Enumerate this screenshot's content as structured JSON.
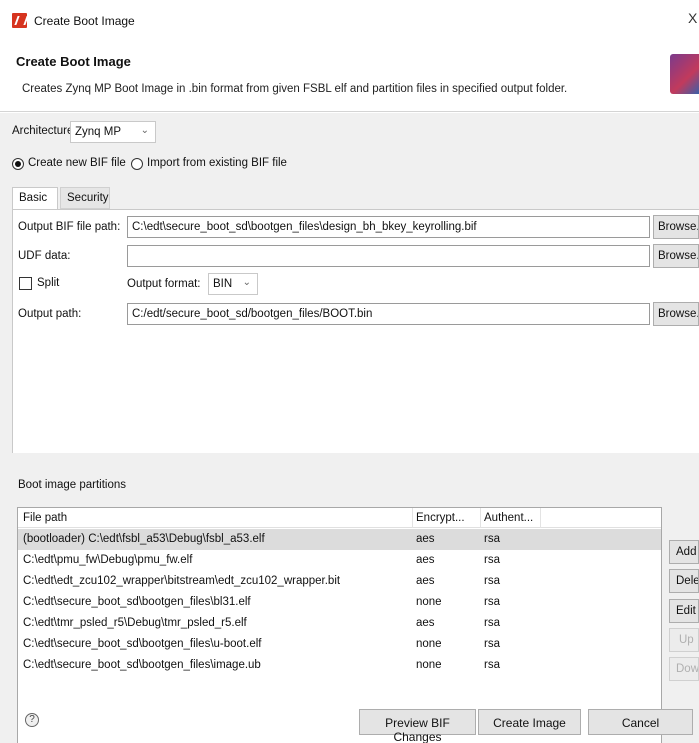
{
  "window": {
    "title": "Create Boot Image",
    "close": "X"
  },
  "header": {
    "title": "Create Boot Image",
    "description": "Creates Zynq MP Boot Image in .bin format from given FSBL elf and partition files in specified output folder."
  },
  "architecture": {
    "label": "Architecture:",
    "value": "Zynq MP"
  },
  "bif_mode": {
    "create_label": "Create new BIF file",
    "import_label": "Import from existing BIF file",
    "selected": "create"
  },
  "tabs": [
    {
      "label": "Basic",
      "active": true
    },
    {
      "label": "Security",
      "active": false
    }
  ],
  "basic": {
    "output_bif_label": "Output BIF file path:",
    "output_bif_value": "C:\\edt\\secure_boot_sd\\bootgen_files\\design_bh_bkey_keyrolling.bif",
    "udf_label": "UDF data:",
    "udf_value": "",
    "split_label": "Split",
    "output_format_label": "Output format:",
    "output_format_value": "BIN",
    "output_path_label": "Output path:",
    "output_path_value": "C:/edt/secure_boot_sd/bootgen_files/BOOT.bin",
    "browse_label": "Browse..."
  },
  "partitions": {
    "group_label": "Boot image partitions",
    "columns": [
      "File path",
      "Encrypt...",
      "Authent..."
    ],
    "rows": [
      {
        "path": "(bootloader) C:\\edt\\fsbl_a53\\Debug\\fsbl_a53.elf",
        "encrypt": "aes",
        "auth": "rsa",
        "selected": true
      },
      {
        "path": "C:\\edt\\pmu_fw\\Debug\\pmu_fw.elf",
        "encrypt": "aes",
        "auth": "rsa",
        "selected": false
      },
      {
        "path": "C:\\edt\\edt_zcu102_wrapper\\bitstream\\edt_zcu102_wrapper.bit",
        "encrypt": "aes",
        "auth": "rsa",
        "selected": false
      },
      {
        "path": "C:\\edt\\secure_boot_sd\\bootgen_files\\bl31.elf",
        "encrypt": "none",
        "auth": "rsa",
        "selected": false
      },
      {
        "path": "C:\\edt\\tmr_psled_r5\\Debug\\tmr_psled_r5.elf",
        "encrypt": "aes",
        "auth": "rsa",
        "selected": false
      },
      {
        "path": "C:\\edt\\secure_boot_sd\\bootgen_files\\u-boot.elf",
        "encrypt": "none",
        "auth": "rsa",
        "selected": false
      },
      {
        "path": "C:\\edt\\secure_boot_sd\\bootgen_files\\image.ub",
        "encrypt": "none",
        "auth": "rsa",
        "selected": false
      }
    ],
    "buttons": {
      "add": "Add",
      "delete": "Delete",
      "edit": "Edit",
      "up": "Up",
      "down": "Down"
    }
  },
  "footer": {
    "help": "?",
    "preview": "Preview BIF Changes",
    "create": "Create Image",
    "cancel": "Cancel"
  },
  "colors": {
    "logo": "#d6341f",
    "selected_row": "#dcdcdc",
    "panel_bg": "#f0f0f0"
  }
}
